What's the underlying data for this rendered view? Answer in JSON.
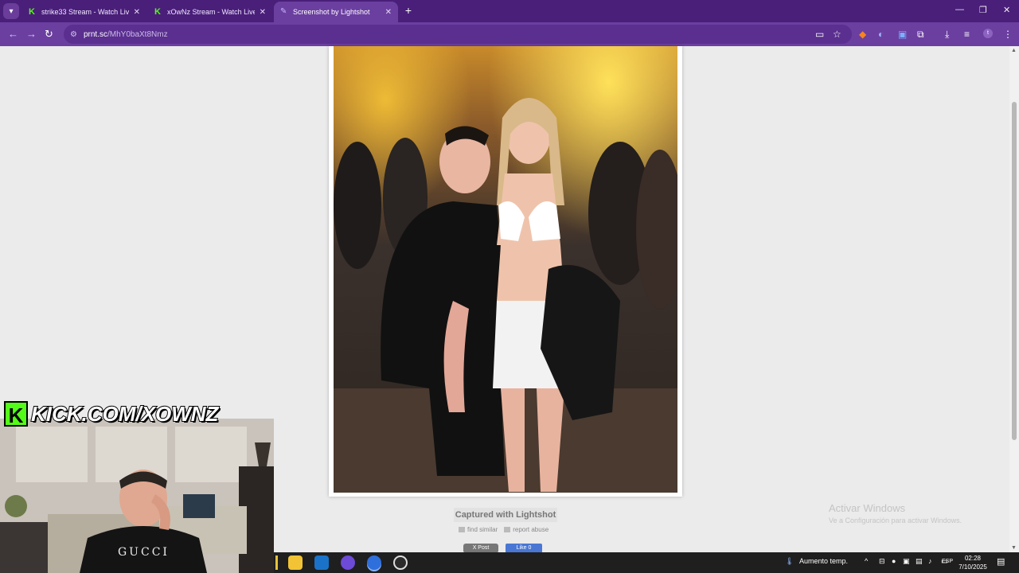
{
  "browser": {
    "tabs": [
      {
        "title": "strike33 Stream - Watch Live on",
        "active": false
      },
      {
        "title": "xOwNz Stream - Watch Live on",
        "active": false
      },
      {
        "title": "Screenshot by Lightshot",
        "active": true
      }
    ],
    "url_host": "prnt.sc",
    "url_path": "/MhY0baXt8Nmz"
  },
  "page": {
    "captured_label": "Captured with Lightshot",
    "find_similar": "find similar",
    "report_abuse": "report abuse",
    "post_label": "X Post",
    "like_label": "Like 0"
  },
  "watermark": {
    "line1": "Activar Windows",
    "line2": "Ve a Configuración para activar Windows."
  },
  "stream": {
    "kick_url": "KICK.COM/XOWNZ",
    "shirt_text": "GUCCI"
  },
  "taskbar": {
    "weather": "Aumento temp.",
    "language": "ESP",
    "time": "02:28",
    "date": "7/10/2025"
  },
  "colors": {
    "tabbar": "#4a1f7a",
    "toolbar": "#6b3fa0",
    "kick_green": "#53fc18"
  }
}
